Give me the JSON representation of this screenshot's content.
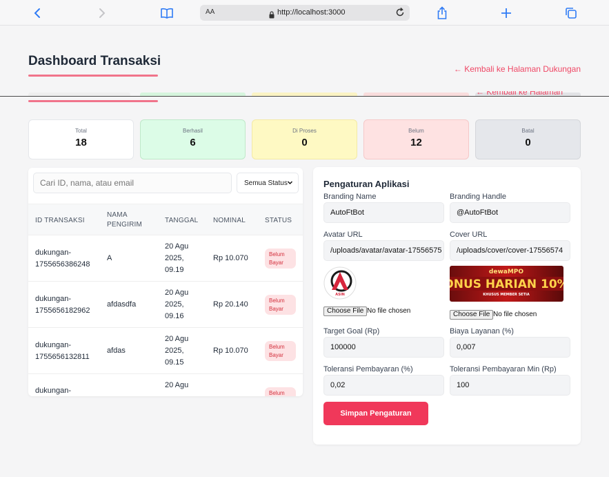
{
  "browser": {
    "url_prefix": "AA",
    "url": "http://localhost:3000"
  },
  "header": {
    "title": "Dashboard Transaksi",
    "back_link": "← Kembali ke Halaman Dukungan"
  },
  "stats": [
    {
      "label": "Total",
      "value": "18",
      "bg": "#ffffff"
    },
    {
      "label": "Berhasil",
      "value": "6",
      "bg": "#dcfce7"
    },
    {
      "label": "Di Proses",
      "value": "0",
      "bg": "#fef9c3"
    },
    {
      "label": "Belum",
      "value": "12",
      "bg": "#fee2e2"
    },
    {
      "label": "Batal",
      "value": "0",
      "bg": "#e5e7eb"
    }
  ],
  "transactions": {
    "search_placeholder": "Cari ID, nama, atau email",
    "status_filter": "Semua Status",
    "headers": {
      "id": "ID TRANSAKSI",
      "name_line1": "NAMA",
      "name_line2": "PENGIRIM",
      "date": "TANGGAL",
      "amount": "NOMINAL",
      "status": "STATUS"
    },
    "rows": [
      {
        "id_line1": "dukungan-",
        "id_line2": "1755656386248",
        "name": "A",
        "date_line1": "20 Agu",
        "date_line2": "2025,",
        "date_line3": "09.19",
        "amount": "Rp 10.070",
        "status_line1": "Belum",
        "status_line2": "Bayar"
      },
      {
        "id_line1": "dukungan-",
        "id_line2": "1755656182962",
        "name": "afdasdfa",
        "date_line1": "20 Agu",
        "date_line2": "2025,",
        "date_line3": "09.16",
        "amount": "Rp 20.140",
        "status_line1": "Belum",
        "status_line2": "Bayar"
      },
      {
        "id_line1": "dukungan-",
        "id_line2": "1755656132811",
        "name": "afdas",
        "date_line1": "20 Agu",
        "date_line2": "2025,",
        "date_line3": "09.15",
        "amount": "Rp 10.070",
        "status_line1": "Belum",
        "status_line2": "Bayar"
      },
      {
        "id_line1": "dukungan-",
        "id_line2": "",
        "name": "",
        "date_line1": "20 Agu",
        "date_line2": "",
        "date_line3": "",
        "amount": "",
        "status_line1": "Belum",
        "status_line2": ""
      }
    ]
  },
  "settings": {
    "title": "Pengaturan Aplikasi",
    "branding_name_label": "Branding Name",
    "branding_name": "AutoFtBot",
    "branding_handle_label": "Branding Handle",
    "branding_handle": "@AutoFtBot",
    "avatar_url_label": "Avatar URL",
    "avatar_url": "/uploads/avatar/avatar-17556575",
    "cover_url_label": "Cover URL",
    "cover_url": "/uploads/cover/cover-17556574",
    "choose_file": "Choose File",
    "no_file": "No file chosen",
    "target_goal_label": "Target Goal (Rp)",
    "target_goal": "100000",
    "service_fee_label": "Biaya Layanan (%)",
    "service_fee": "0,007",
    "payment_tolerance_label": "Toleransi Pembayaran (%)",
    "payment_tolerance": "0,02",
    "payment_tolerance_min_label": "Toleransi Pembayaran Min (Rp)",
    "payment_tolerance_min": "100",
    "save_button": "Simpan Pengaturan",
    "avatar_logo_text": "ASIN",
    "cover_brand": "dewaMPO",
    "cover_banner": "ONUS HARIAN 10%",
    "cover_sub": "KHUSUS MEMBER SETIA"
  },
  "colors": {
    "accent": "#f0385a",
    "link": "#ef4765",
    "badge_bg": "#fde2e4",
    "badge_text": "#d32f3c"
  }
}
